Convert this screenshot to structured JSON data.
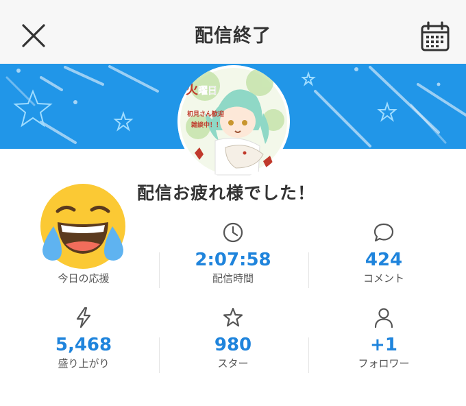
{
  "header": {
    "title": "配信終了",
    "close_icon": "close-icon",
    "calendar_icon": "calendar-icon"
  },
  "banner": {
    "background_color": "#2196e8",
    "avatar_text_lines": [
      "初見さん歓迎",
      "雑談中！！"
    ]
  },
  "main": {
    "thanks_message": "配信お疲れ様でした！"
  },
  "stats": [
    {
      "icon": "tears-of-joy-emoji",
      "value": "",
      "label": "今日の応援"
    },
    {
      "icon": "clock-icon",
      "value": "2:07:58",
      "label": "配信時間"
    },
    {
      "icon": "comment-bubble-icon",
      "value": "424",
      "label": "コメント"
    },
    {
      "icon": "lightning-icon",
      "value": "5,468",
      "label": "盛り上がり"
    },
    {
      "icon": "star-icon",
      "value": "980",
      "label": "スター"
    },
    {
      "icon": "person-icon",
      "value": "+1",
      "label": "フォロワー"
    }
  ],
  "colors": {
    "accent": "#1f84dc",
    "banner": "#2196e8",
    "header_bg": "#f7f7f7"
  }
}
